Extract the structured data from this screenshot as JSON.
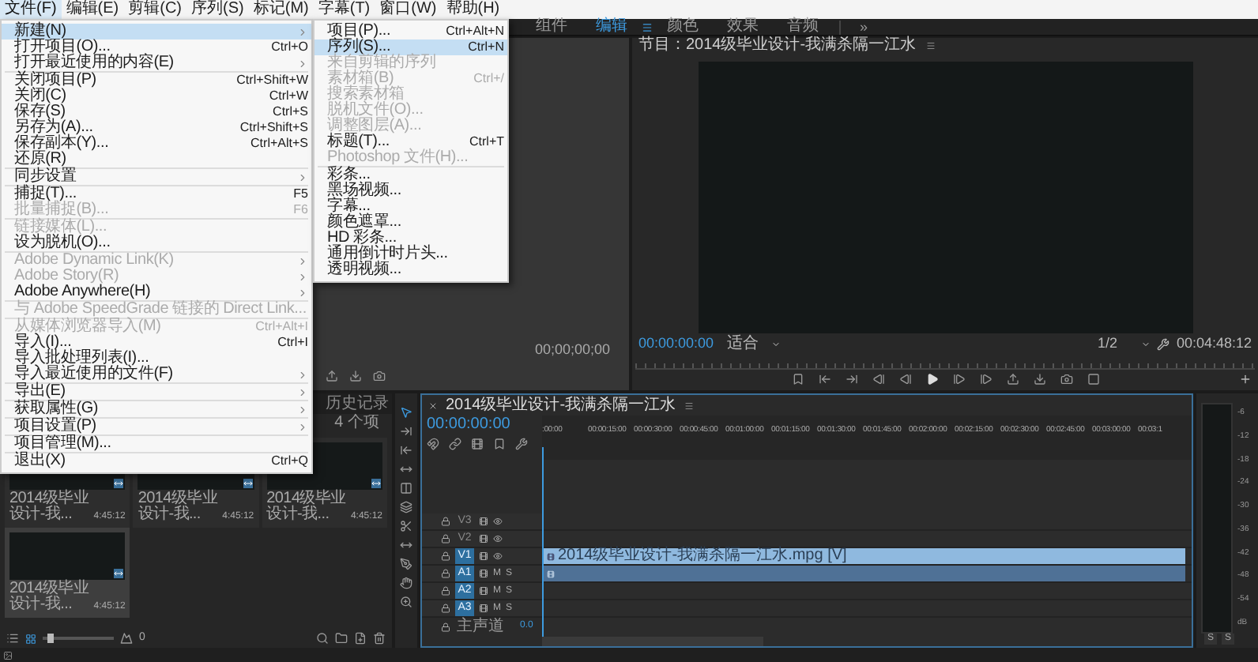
{
  "menu_bar": [
    {
      "label": "文件(F)",
      "selected": true
    },
    {
      "label": "编辑(E)",
      "selected": false
    },
    {
      "label": "剪辑(C)",
      "selected": false
    },
    {
      "label": "序列(S)",
      "selected": false
    },
    {
      "label": "标记(M)",
      "selected": false
    },
    {
      "label": "字幕(T)",
      "selected": false
    },
    {
      "label": "窗口(W)",
      "selected": false
    },
    {
      "label": "帮助(H)",
      "selected": false
    }
  ],
  "workspaces": [
    {
      "label": "组件",
      "selected": false
    },
    {
      "label": "编辑",
      "selected": true
    },
    {
      "label": "颜色",
      "selected": false
    },
    {
      "label": "效果",
      "selected": false
    },
    {
      "label": "音频",
      "selected": false
    }
  ],
  "workspace_more": "»",
  "file_menu": {
    "items": [
      {
        "kind": "item",
        "label": "新建(N)",
        "submenu": true,
        "selected": true,
        "disabled": false
      },
      {
        "kind": "item",
        "label": "打开项目(O)...",
        "shortcut": "Ctrl+O",
        "submenu": false,
        "selected": false,
        "disabled": false
      },
      {
        "kind": "item",
        "label": "打开最近使用的内容(E)",
        "submenu": true,
        "selected": false,
        "disabled": false
      },
      {
        "kind": "separator"
      },
      {
        "kind": "item",
        "label": "关闭项目(P)",
        "shortcut": "Ctrl+Shift+W",
        "submenu": false,
        "selected": false,
        "disabled": false
      },
      {
        "kind": "item",
        "label": "关闭(C)",
        "shortcut": "Ctrl+W",
        "submenu": false,
        "selected": false,
        "disabled": false
      },
      {
        "kind": "item",
        "label": "保存(S)",
        "shortcut": "Ctrl+S",
        "submenu": false,
        "selected": false,
        "disabled": false
      },
      {
        "kind": "item",
        "label": "另存为(A)...",
        "shortcut": "Ctrl+Shift+S",
        "submenu": false,
        "selected": false,
        "disabled": false
      },
      {
        "kind": "item",
        "label": "保存副本(Y)...",
        "shortcut": "Ctrl+Alt+S",
        "submenu": false,
        "selected": false,
        "disabled": false
      },
      {
        "kind": "item",
        "label": "还原(R)",
        "submenu": false,
        "selected": false,
        "disabled": false
      },
      {
        "kind": "separator"
      },
      {
        "kind": "item",
        "label": "同步设置",
        "submenu": true,
        "selected": false,
        "disabled": false
      },
      {
        "kind": "separator"
      },
      {
        "kind": "item",
        "label": "捕捉(T)...",
        "shortcut": "F5",
        "submenu": false,
        "selected": false,
        "disabled": false
      },
      {
        "kind": "item",
        "label": "批量捕捉(B)...",
        "shortcut": "F6",
        "submenu": false,
        "selected": false,
        "disabled": true
      },
      {
        "kind": "separator"
      },
      {
        "kind": "item",
        "label": "链接媒体(L)...",
        "submenu": false,
        "selected": false,
        "disabled": true
      },
      {
        "kind": "item",
        "label": "设为脱机(O)...",
        "submenu": false,
        "selected": false,
        "disabled": false
      },
      {
        "kind": "separator"
      },
      {
        "kind": "item",
        "label": "Adobe Dynamic Link(K)",
        "submenu": true,
        "selected": false,
        "disabled": true
      },
      {
        "kind": "item",
        "label": "Adobe Story(R)",
        "submenu": true,
        "selected": false,
        "disabled": true
      },
      {
        "kind": "item",
        "label": "Adobe Anywhere(H)",
        "submenu": true,
        "selected": false,
        "disabled": false
      },
      {
        "kind": "separator"
      },
      {
        "kind": "item",
        "label": "与 Adobe SpeedGrade 链接的 Direct Link...",
        "submenu": false,
        "selected": false,
        "disabled": true
      },
      {
        "kind": "separator"
      },
      {
        "kind": "item",
        "label": "从媒体浏览器导入(M)",
        "shortcut": "Ctrl+Alt+I",
        "submenu": false,
        "selected": false,
        "disabled": true
      },
      {
        "kind": "item",
        "label": "导入(I)...",
        "shortcut": "Ctrl+I",
        "submenu": false,
        "selected": false,
        "disabled": false
      },
      {
        "kind": "item",
        "label": "导入批处理列表(I)...",
        "submenu": false,
        "selected": false,
        "disabled": false
      },
      {
        "kind": "item",
        "label": "导入最近使用的文件(F)",
        "submenu": true,
        "selected": false,
        "disabled": false
      },
      {
        "kind": "separator"
      },
      {
        "kind": "item",
        "label": "导出(E)",
        "submenu": true,
        "selected": false,
        "disabled": false
      },
      {
        "kind": "separator"
      },
      {
        "kind": "item",
        "label": "获取属性(G)",
        "submenu": true,
        "selected": false,
        "disabled": false
      },
      {
        "kind": "separator"
      },
      {
        "kind": "item",
        "label": "项目设置(P)",
        "submenu": true,
        "selected": false,
        "disabled": false
      },
      {
        "kind": "separator"
      },
      {
        "kind": "item",
        "label": "项目管理(M)...",
        "submenu": false,
        "selected": false,
        "disabled": false
      },
      {
        "kind": "separator"
      },
      {
        "kind": "item",
        "label": "退出(X)",
        "shortcut": "Ctrl+Q",
        "submenu": false,
        "selected": false,
        "disabled": false
      }
    ]
  },
  "new_submenu": {
    "items": [
      {
        "kind": "item",
        "label": "项目(P)...",
        "shortcut": "Ctrl+Alt+N",
        "submenu": false,
        "selected": false,
        "disabled": false
      },
      {
        "kind": "item",
        "label": "序列(S)...",
        "shortcut": "Ctrl+N",
        "submenu": false,
        "selected": true,
        "disabled": false
      },
      {
        "kind": "item",
        "label": "来自剪辑的序列",
        "submenu": false,
        "selected": false,
        "disabled": true
      },
      {
        "kind": "item",
        "label": "素材箱(B)",
        "shortcut": "Ctrl+/",
        "submenu": false,
        "selected": false,
        "disabled": true
      },
      {
        "kind": "item",
        "label": "搜索素材箱",
        "submenu": false,
        "selected": false,
        "disabled": true
      },
      {
        "kind": "item",
        "label": "脱机文件(O)...",
        "submenu": false,
        "selected": false,
        "disabled": true
      },
      {
        "kind": "item",
        "label": "调整图层(A)...",
        "submenu": false,
        "selected": false,
        "disabled": true
      },
      {
        "kind": "item",
        "label": "标题(T)...",
        "shortcut": "Ctrl+T",
        "submenu": false,
        "selected": false,
        "disabled": false
      },
      {
        "kind": "item",
        "label": "Photoshop 文件(H)...",
        "submenu": false,
        "selected": false,
        "disabled": true
      },
      {
        "kind": "separator"
      },
      {
        "kind": "item",
        "label": "彩条...",
        "submenu": false,
        "selected": false,
        "disabled": false
      },
      {
        "kind": "item",
        "label": "黑场视频...",
        "submenu": false,
        "selected": false,
        "disabled": false
      },
      {
        "kind": "item",
        "label": "字幕...",
        "submenu": false,
        "selected": false,
        "disabled": false
      },
      {
        "kind": "item",
        "label": "颜色遮罩...",
        "submenu": false,
        "selected": false,
        "disabled": false
      },
      {
        "kind": "item",
        "label": "HD 彩条...",
        "submenu": false,
        "selected": false,
        "disabled": false
      },
      {
        "kind": "item",
        "label": "通用倒计时片头...",
        "submenu": false,
        "selected": false,
        "disabled": false
      },
      {
        "kind": "item",
        "label": "透明视频...",
        "submenu": false,
        "selected": false,
        "disabled": false
      }
    ]
  },
  "source_monitor": {
    "timecode": "00;00;00;00"
  },
  "program_monitor": {
    "title": "节目：2014级毕业设计-我满杀隔一江水",
    "timecode": "00:00:00:00",
    "zoom": "适合",
    "resolution": "1/2",
    "duration": "00:04:48:12"
  },
  "project": {
    "tabs": [
      {
        "label": "历史记录",
        "selected": false
      }
    ],
    "item_count": "4 个项",
    "zoom_value": "0",
    "zoom_slider": {
      "level": 0.1
    },
    "items": [
      {
        "name": "2014级毕业设计-我...",
        "duration": "4:45:12",
        "selected": false
      },
      {
        "name": "2014级毕业设计-我...",
        "duration": "4:45:12",
        "selected": false
      },
      {
        "name": "2014级毕业设计-我...",
        "duration": "4:45:12",
        "selected": false
      },
      {
        "name": "2014级毕业设计-我...",
        "duration": "4:45:12",
        "selected": true
      }
    ]
  },
  "timeline": {
    "tab": "2014级毕业设计-我满杀隔一江水",
    "timecode": "00:00:00:00",
    "ruler": [
      ":00:00",
      "00:00:15:00",
      "00:00:30:00",
      "00:00:45:00",
      "00:01:00:00",
      "00:01:15:00",
      "00:01:30:00",
      "00:01:45:00",
      "00:02:00:00",
      "00:02:15:00",
      "00:02:30:00",
      "00:02:45:00",
      "00:03:00:00",
      "00:03:1"
    ],
    "tracks": [
      {
        "kind": "video",
        "name": "V3",
        "targeted": false,
        "clip": false
      },
      {
        "kind": "video",
        "name": "V2",
        "targeted": false,
        "clip": false
      },
      {
        "kind": "video",
        "name": "V1",
        "targeted": true,
        "clip": true,
        "clip_label": "2014级毕业设计-我满杀隔一江水.mpg [V]"
      },
      {
        "kind": "audio",
        "name": "A1",
        "targeted": true,
        "clip": true,
        "mute": "M",
        "solo": "S"
      },
      {
        "kind": "audio",
        "name": "A2",
        "targeted": true,
        "clip": false,
        "mute": "M",
        "solo": "S"
      },
      {
        "kind": "audio",
        "name": "A3",
        "targeted": true,
        "clip": false,
        "mute": "M",
        "solo": "S"
      }
    ],
    "master": {
      "name": "主声道",
      "value": "0.0"
    }
  },
  "meter": {
    "scale": [
      "-6",
      "-12",
      "-18",
      "-24",
      "-30",
      "-36",
      "-42",
      "-48",
      "-54",
      "dB"
    ],
    "solo_buttons": [
      "S",
      "S"
    ]
  }
}
